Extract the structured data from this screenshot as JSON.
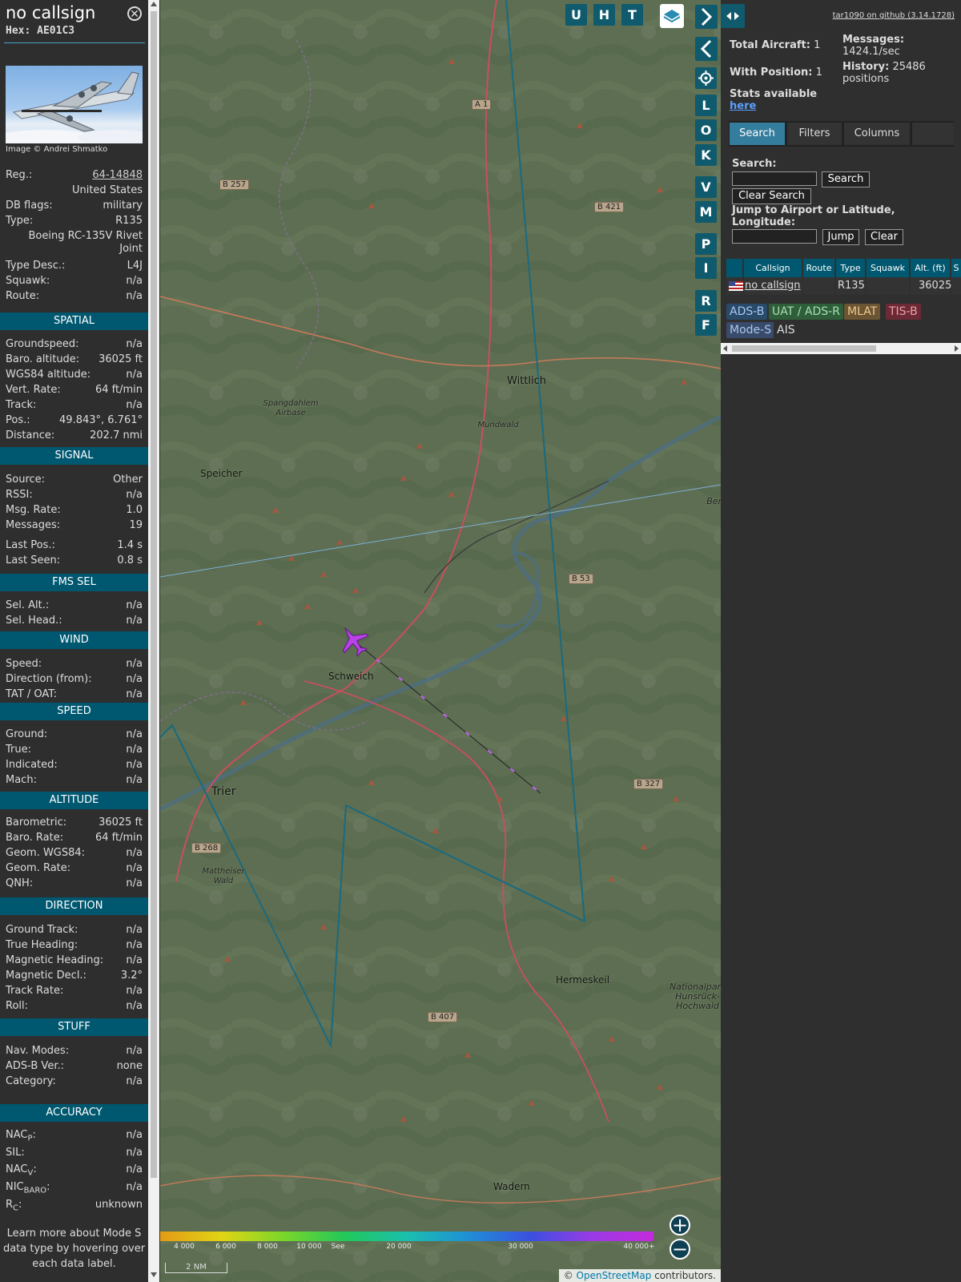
{
  "info": {
    "callsign": "no callsign",
    "hex": "Hex: AE01C3",
    "photo_credit": "Image © Andrei Shmatko",
    "basic": [
      {
        "label": "Reg.:",
        "value": "64-14848"
      },
      {
        "label": "",
        "value": "United States"
      },
      {
        "label": "DB flags:",
        "value": "military"
      },
      {
        "label": "Type:",
        "value": "R135"
      },
      {
        "label": "",
        "value": "Boeing RC-135V Rivet Joint"
      },
      {
        "label": "Type Desc.:",
        "value": "L4J"
      },
      {
        "label": "Squawk:",
        "value": "n/a"
      },
      {
        "label": "Route:",
        "value": "n/a"
      }
    ],
    "sections": [
      {
        "title": "SPATIAL",
        "rows": [
          {
            "label": "Groundspeed:",
            "value": "n/a"
          },
          {
            "label": "Baro. altitude:",
            "value": "36025 ft"
          },
          {
            "label": "WGS84 altitude:",
            "value": "n/a"
          },
          {
            "label": "Vert. Rate:",
            "value": "64 ft/min"
          },
          {
            "label": "Track:",
            "value": "n/a"
          },
          {
            "label": "Pos.:",
            "value": "49.843°, 6.761°"
          },
          {
            "label": "Distance:",
            "value": "202.7 nmi"
          }
        ]
      },
      {
        "title": "SIGNAL",
        "rows": [
          {
            "label": "Source:",
            "value": "Other"
          },
          {
            "label": "RSSI:",
            "value": "n/a"
          },
          {
            "label": "Msg. Rate:",
            "value": "1.0"
          },
          {
            "label": "Messages:",
            "value": "19"
          },
          {
            "label": "Last Pos.:",
            "value": "1.4 s"
          },
          {
            "label": "Last Seen:",
            "value": "0.8 s"
          }
        ]
      },
      {
        "title": "FMS SEL",
        "rows": [
          {
            "label": "Sel. Alt.:",
            "value": "n/a"
          },
          {
            "label": "Sel. Head.:",
            "value": "n/a"
          }
        ]
      },
      {
        "title": "WIND",
        "rows": [
          {
            "label": "Speed:",
            "value": "n/a"
          },
          {
            "label": "Direction (from):",
            "value": "n/a"
          },
          {
            "label": "TAT / OAT:",
            "value": "n/a"
          }
        ]
      },
      {
        "title": "SPEED",
        "rows": [
          {
            "label": "Ground:",
            "value": "n/a"
          },
          {
            "label": "True:",
            "value": "n/a"
          },
          {
            "label": "Indicated:",
            "value": "n/a"
          },
          {
            "label": "Mach:",
            "value": "n/a"
          }
        ]
      },
      {
        "title": "ALTITUDE",
        "rows": [
          {
            "label": "Barometric:",
            "value": "36025 ft"
          },
          {
            "label": "Baro. Rate:",
            "value": "64 ft/min"
          },
          {
            "label": "Geom. WGS84:",
            "value": "n/a"
          },
          {
            "label": "Geom. Rate:",
            "value": "n/a"
          },
          {
            "label": "QNH:",
            "value": "n/a"
          }
        ]
      },
      {
        "title": "DIRECTION",
        "rows": [
          {
            "label": "Ground Track:",
            "value": "n/a"
          },
          {
            "label": "True Heading:",
            "value": "n/a"
          },
          {
            "label": "Magnetic Heading:",
            "value": "n/a"
          },
          {
            "label": "Magnetic Decl.:",
            "value": "3.2°"
          },
          {
            "label": "Track Rate:",
            "value": "n/a"
          },
          {
            "label": "Roll:",
            "value": "n/a"
          }
        ]
      },
      {
        "title": "STUFF",
        "rows": [
          {
            "label": "Nav. Modes:",
            "value": "n/a"
          },
          {
            "label": "ADS-B Ver.:",
            "value": "none"
          },
          {
            "label": "Category:",
            "value": "n/a"
          }
        ]
      }
    ],
    "accuracy": {
      "title": "ACCURACY",
      "rows": [
        {
          "label": "NAC",
          "sub": "P",
          "value": "n/a"
        },
        {
          "label": "SIL:",
          "sub": "",
          "value": "n/a"
        },
        {
          "label": "NAC",
          "sub": "V",
          "value": "n/a"
        },
        {
          "label": "NIC",
          "sub": "BARO",
          "value": "n/a"
        },
        {
          "label": "R",
          "sub": "C",
          "value": "unknown"
        }
      ]
    },
    "footnote": "Learn more about Mode S data type by hovering over each data label."
  },
  "map": {
    "toolbar_top": [
      "U",
      "H",
      "T"
    ],
    "toolbar_side": [
      "L",
      "O",
      "K",
      "V",
      "M",
      "P",
      "I",
      "R",
      "F"
    ],
    "places": [
      {
        "name": "Wittlich"
      },
      {
        "name": "Speicher"
      },
      {
        "name": "Schweich"
      },
      {
        "name": "Trier"
      },
      {
        "name": "Hermeskeil"
      },
      {
        "name": "Wadern"
      },
      {
        "name": "Spangdahlem Airbase"
      },
      {
        "name": "Bernk Ku"
      },
      {
        "name": "Mattheiser Wald"
      },
      {
        "name": "Nationalpark Hunsrück-Hochwald"
      },
      {
        "name": "Mundwald"
      }
    ],
    "roads": [
      "A 1",
      "B 257",
      "B 421",
      "B 53",
      "B 327",
      "B 268",
      "B 407"
    ],
    "altitude_scale": [
      "4 000",
      "6 000",
      "8 000",
      "10 000",
      "See",
      "20 000",
      "30 000",
      "40 000+"
    ],
    "scale_bar": "2 NM",
    "attribution_prefix": "©",
    "attribution_link": "OpenStreetMap",
    "attribution_suffix": "contributors."
  },
  "right": {
    "github": "tar1090 on github (3.14.1728)",
    "total_aircraft_label": "Total Aircraft:",
    "total_aircraft": "1",
    "with_position_label": "With Position:",
    "with_position": "1",
    "messages_label": "Messages:",
    "messages": "1424.1/sec",
    "history_label": "History:",
    "history": "25486 positions",
    "stats_label": "Stats available",
    "stats_link": "here",
    "tabs": [
      "Search",
      "Filters",
      "Columns"
    ],
    "search_label": "Search:",
    "search_button": "Search",
    "clear_search_button": "Clear Search",
    "jump_label": "Jump to Airport or Latitude, Longitude:",
    "jump_button": "Jump",
    "clear_button": "Clear",
    "table_headers": [
      "Callsign",
      "Route",
      "Type",
      "Squawk",
      "Alt. (ft)",
      "S"
    ],
    "table_row": {
      "callsign": "no callsign",
      "route": "",
      "type": "R135",
      "squawk": "",
      "alt": "36025"
    },
    "sources": [
      {
        "label": "ADS-B",
        "color": "#2a4a6a"
      },
      {
        "label": "UAT / ADS-R",
        "color": "#2e5e3a"
      },
      {
        "label": "MLAT",
        "color": "#6b5533"
      },
      {
        "label": "TIS-B",
        "color": "#6b2a35"
      },
      {
        "label": "Mode-S",
        "color": "#3a4a6a"
      },
      {
        "label": "AIS",
        "color": "#2f2f2f"
      }
    ]
  }
}
